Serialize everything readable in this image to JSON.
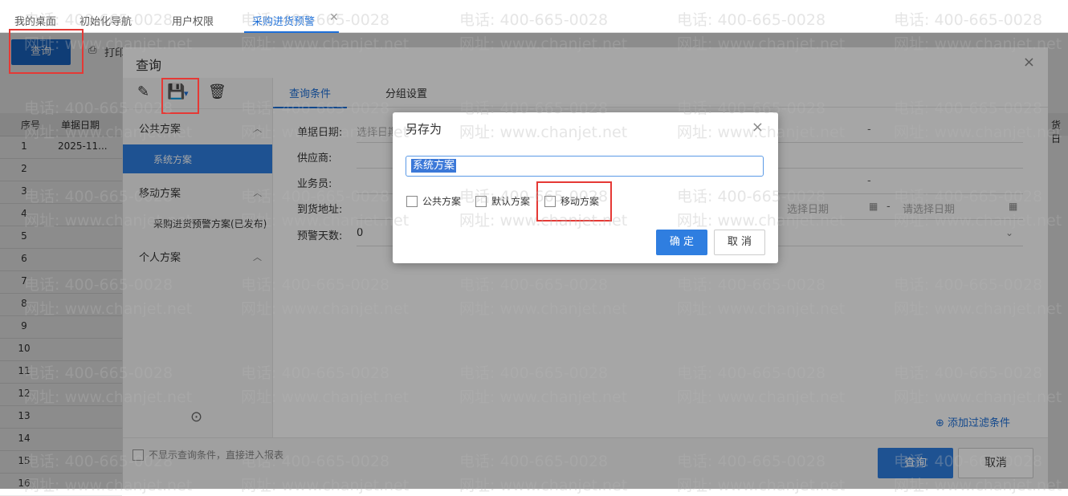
{
  "tabs": [
    {
      "label": "我的桌面"
    },
    {
      "label": "初始化导航"
    },
    {
      "label": "用户权限"
    },
    {
      "label": "采购进货预警"
    }
  ],
  "tab_close_glyph": "✕",
  "toolbar": {
    "query_label": "查询",
    "print_label": "打印"
  },
  "grid": {
    "headers": {
      "index": "序号",
      "date": "单据日期",
      "right": "货日"
    },
    "rows": [
      {
        "index": "1",
        "date": "2025-11..."
      },
      {
        "index": "2",
        "date": ""
      },
      {
        "index": "3",
        "date": ""
      },
      {
        "index": "4",
        "date": ""
      },
      {
        "index": "5",
        "date": ""
      },
      {
        "index": "6",
        "date": ""
      },
      {
        "index": "7",
        "date": ""
      },
      {
        "index": "8",
        "date": ""
      },
      {
        "index": "9",
        "date": ""
      },
      {
        "index": "10",
        "date": ""
      },
      {
        "index": "11",
        "date": ""
      },
      {
        "index": "12",
        "date": ""
      },
      {
        "index": "13",
        "date": ""
      },
      {
        "index": "14",
        "date": ""
      },
      {
        "index": "15",
        "date": ""
      },
      {
        "index": "16",
        "date": ""
      }
    ]
  },
  "query_dialog": {
    "title": "查询",
    "close_glyph": "×",
    "left": {
      "sections": [
        {
          "label": "公共方案",
          "items": [
            {
              "label": "系统方案",
              "selected": true
            }
          ]
        },
        {
          "label": "移动方案",
          "items": [
            {
              "label": "采购进货预警方案(已发布)",
              "selected": false
            }
          ]
        },
        {
          "label": "个人方案",
          "items": []
        }
      ]
    },
    "tabs": {
      "conditions": "查询条件",
      "grouping": "分组设置"
    },
    "fields": {
      "date_label": "单据日期:",
      "date_placeholder": "选择日期",
      "supplier_label": "供应商:",
      "salesman_label": "业务员:",
      "address_label": "到货地址:",
      "warning_days_label": "预警天数:",
      "warning_days_value": "0",
      "right_date_placeholder": "选择日期",
      "right_date_placeholder2": "请选择日期"
    },
    "add_filter": "添加过滤条件",
    "footer": {
      "skip_text": "不显示查询条件，直接进入报表",
      "query": "查询",
      "cancel": "取消"
    }
  },
  "save_as_dialog": {
    "title": "另存为",
    "close_glyph": "×",
    "input_value": "系统方案",
    "checkboxes": [
      {
        "label": "公共方案",
        "checked": false
      },
      {
        "label": "默认方案",
        "checked": false
      },
      {
        "label": "移动方案",
        "checked": false
      }
    ],
    "ok": "确 定",
    "cancel": "取 消"
  },
  "watermark": {
    "phone": "电话: 400-665-0028",
    "site": "网址: www.chanjet.net"
  },
  "colors": {
    "primary": "#1d6fd8",
    "selected_bg": "#2f7ee0",
    "highlight": "#e53935"
  }
}
